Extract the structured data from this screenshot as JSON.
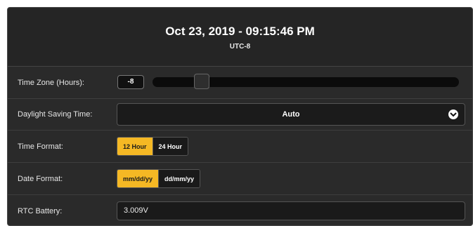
{
  "header": {
    "datetime": "Oct 23, 2019 - 09:15:46 PM",
    "timezone": "UTC-8"
  },
  "time_zone": {
    "label": "Time Zone (Hours):",
    "value": "-8",
    "slider_fraction": 0.16
  },
  "daylight_saving": {
    "label": "Daylight Saving Time:",
    "selected": "Auto"
  },
  "time_format": {
    "label": "Time Format:",
    "options": [
      "12 Hour",
      "24 Hour"
    ],
    "selected": "12 Hour"
  },
  "date_format": {
    "label": "Date Format:",
    "options": [
      "mm/dd/yy",
      "dd/mm/yy"
    ],
    "selected": "mm/dd/yy"
  },
  "rtc_battery": {
    "label": "RTC Battery:",
    "value": "3.009V"
  },
  "colors": {
    "accent": "#f5b824",
    "panel": "#2b2b2b"
  }
}
